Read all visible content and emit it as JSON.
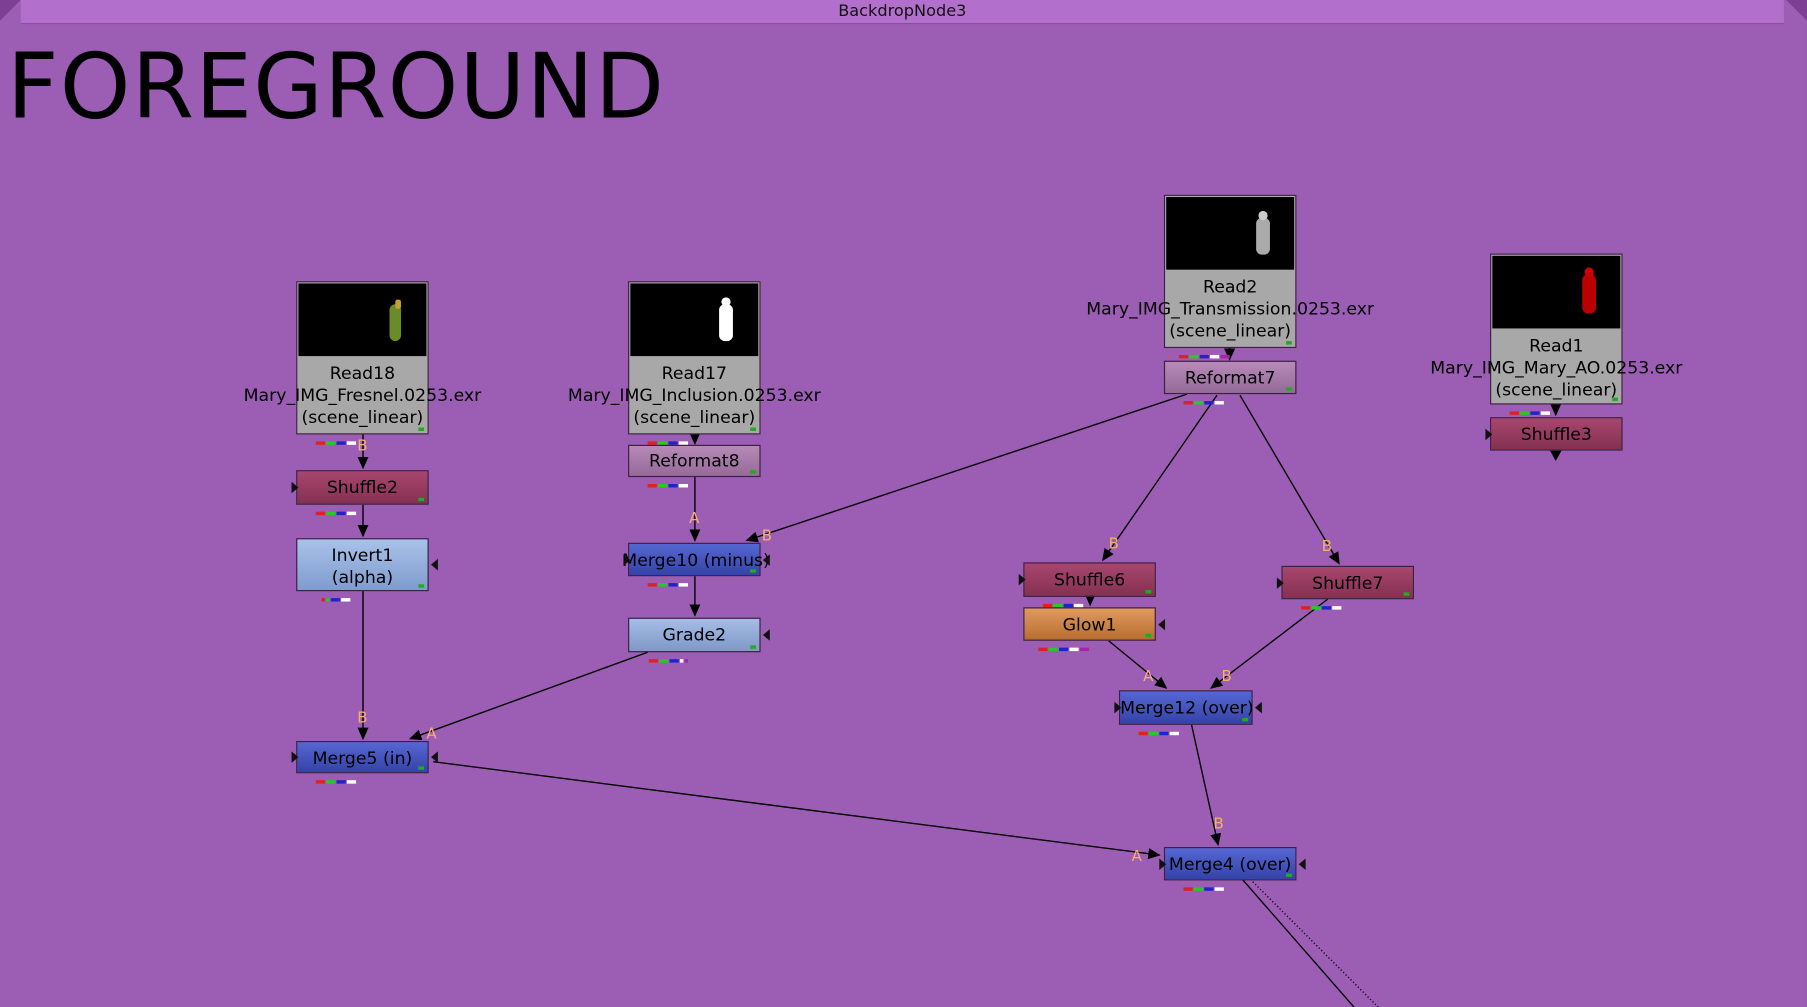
{
  "backdrop": {
    "title": "BackdropNode3",
    "label": "FOREGROUND"
  },
  "nodes": {
    "read18": {
      "name": "Read18",
      "file": "Mary_IMG_Fresnel.0253.exr",
      "colorspace": "(scene_linear)"
    },
    "read17": {
      "name": "Read17",
      "file": "Mary_IMG_Inclusion.0253.exr",
      "colorspace": "(scene_linear)"
    },
    "read2": {
      "name": "Read2",
      "file": "Mary_IMG_Transmission.0253.exr",
      "colorspace": "(scene_linear)"
    },
    "read1": {
      "name": "Read1",
      "file": "Mary_IMG_Mary_AO.0253.exr",
      "colorspace": "(scene_linear)"
    },
    "shuffle2": {
      "name": "Shuffle2"
    },
    "shuffle3": {
      "name": "Shuffle3"
    },
    "shuffle6": {
      "name": "Shuffle6"
    },
    "shuffle7": {
      "name": "Shuffle7"
    },
    "reformat7": {
      "name": "Reformat7"
    },
    "reformat8": {
      "name": "Reformat8"
    },
    "invert1": {
      "name": "Invert1",
      "sub": "(alpha)"
    },
    "grade2": {
      "name": "Grade2"
    },
    "merge10": {
      "name": "Merge10 (minus)"
    },
    "merge5": {
      "name": "Merge5 (in)"
    },
    "merge12": {
      "name": "Merge12 (over)"
    },
    "merge4": {
      "name": "Merge4 (over)"
    },
    "glow1": {
      "name": "Glow1"
    }
  },
  "inputs": {
    "a": "A",
    "b": "B"
  },
  "colors": {
    "backdrop": "#9c5db4",
    "read": "#a8a8a8",
    "shuffle": "#a8466f",
    "reformat": "#b78ab8",
    "merge": "#4455c0",
    "color_correct": "#a6bde6",
    "glow": "#e09a5e",
    "input_label": "#f5b070"
  }
}
